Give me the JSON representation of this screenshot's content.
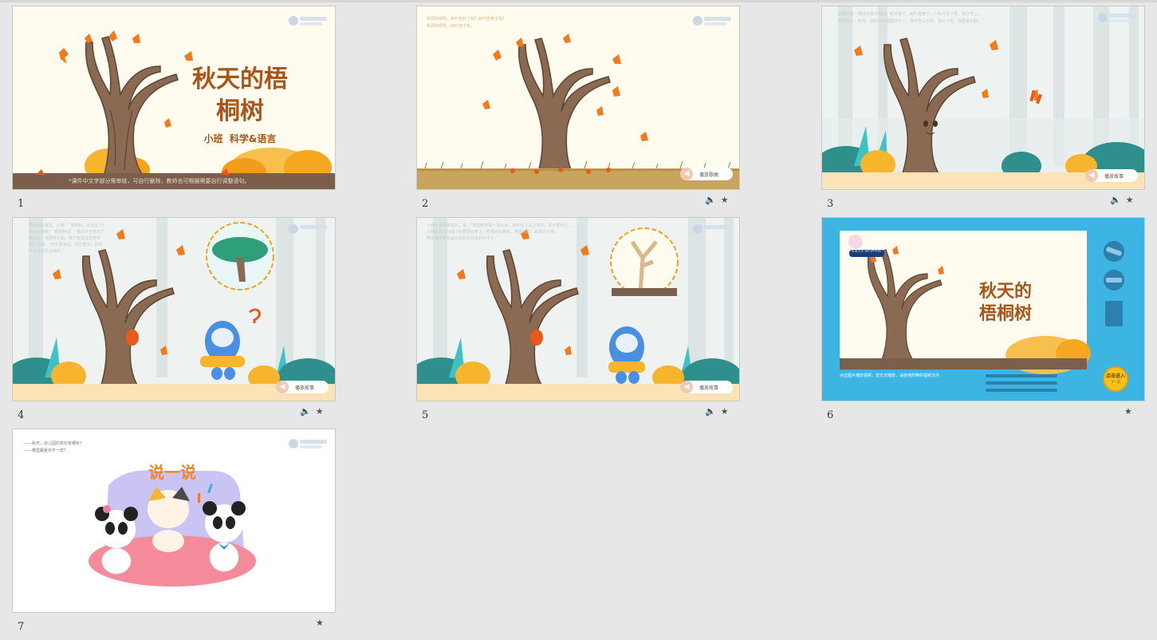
{
  "slides": [
    {
      "number": "1",
      "title_line1": "秋天的梧",
      "title_line2": "桐树",
      "subtitle": "小班  科学&语言",
      "footer": "*课件中文字部分需审核，可自行删除，教师也可根据需要自行调整语句。",
      "logo": "培养双语 幼儿园"
    },
    {
      "number": "2",
      "text_line1": "秋风吹呀吹，树叶变红了吗？树叶变黄了吗？",
      "text_line2": "秋风吹呀吹，树叶落下来。",
      "play_label": "播放歌曲",
      "logo": "培养双语"
    },
    {
      "number": "3",
      "text_line1": "梧桐树是一棵很高很大的树，秋天来了，树叶变黄了，一片片往下落，落在地上，",
      "text_line2": "梧桐树说：哎呀，我的叶子都要掉光了，我可怎么办呀，我好冷呀，我要穿衣服。",
      "play_label": "播放故事",
      "logo": "培养双语"
    },
    {
      "number": "4",
      "text_lines": [
        "梧桐树在哭泣，小熊：“梧桐树，你怎么了？",
        "为什么哭呀？”梧桐树说：“我的叶子掉光了，",
        "我好冷，我要穿衣服，我不能变成光秃秃",
        "的。”小熊：“你不要难过，明年春天，你的",
        "叶子又会长出来的。”"
      ],
      "play_label": "播放故事",
      "logo": "培养双语"
    },
    {
      "number": "5",
      "text_lines": [
        "小熊听梧桐树说完，说：“梧桐树你是一棵大树，树叶掉了是正常的，你不要伤心，",
        "小熊把自己的围巾给梧桐树穿上，梧桐树好暖和，梧桐树说：谢谢你小熊，",
        "明年春天我又会长出好多好多的叶子了。”"
      ],
      "play_label": "播放故事",
      "logo": "培养双语"
    },
    {
      "number": "6",
      "brand": "宝宝巴士 幼儿好乐园",
      "title_line1": "秋天的",
      "title_line2": "梧桐树",
      "caption": "点击图片播放视频；若无法播放，请使用附带的视频文件",
      "next_label": "点击进入",
      "next_sub": "下一页"
    },
    {
      "number": "7",
      "text_line1": "——秋天，幼儿园的变化有哪些？",
      "text_line2": "——哪里跟夏天不一样？",
      "heading": "说一说",
      "logo": "培养双语 幼儿园"
    }
  ],
  "icons": {
    "sound": "sound-icon",
    "star": "star-animation-icon"
  },
  "colors": {
    "cream": "#fffbee",
    "orange": "#f5a01e",
    "brown": "#7b5f4a",
    "title": "#a8551a",
    "blue": "#2f9fd8"
  }
}
